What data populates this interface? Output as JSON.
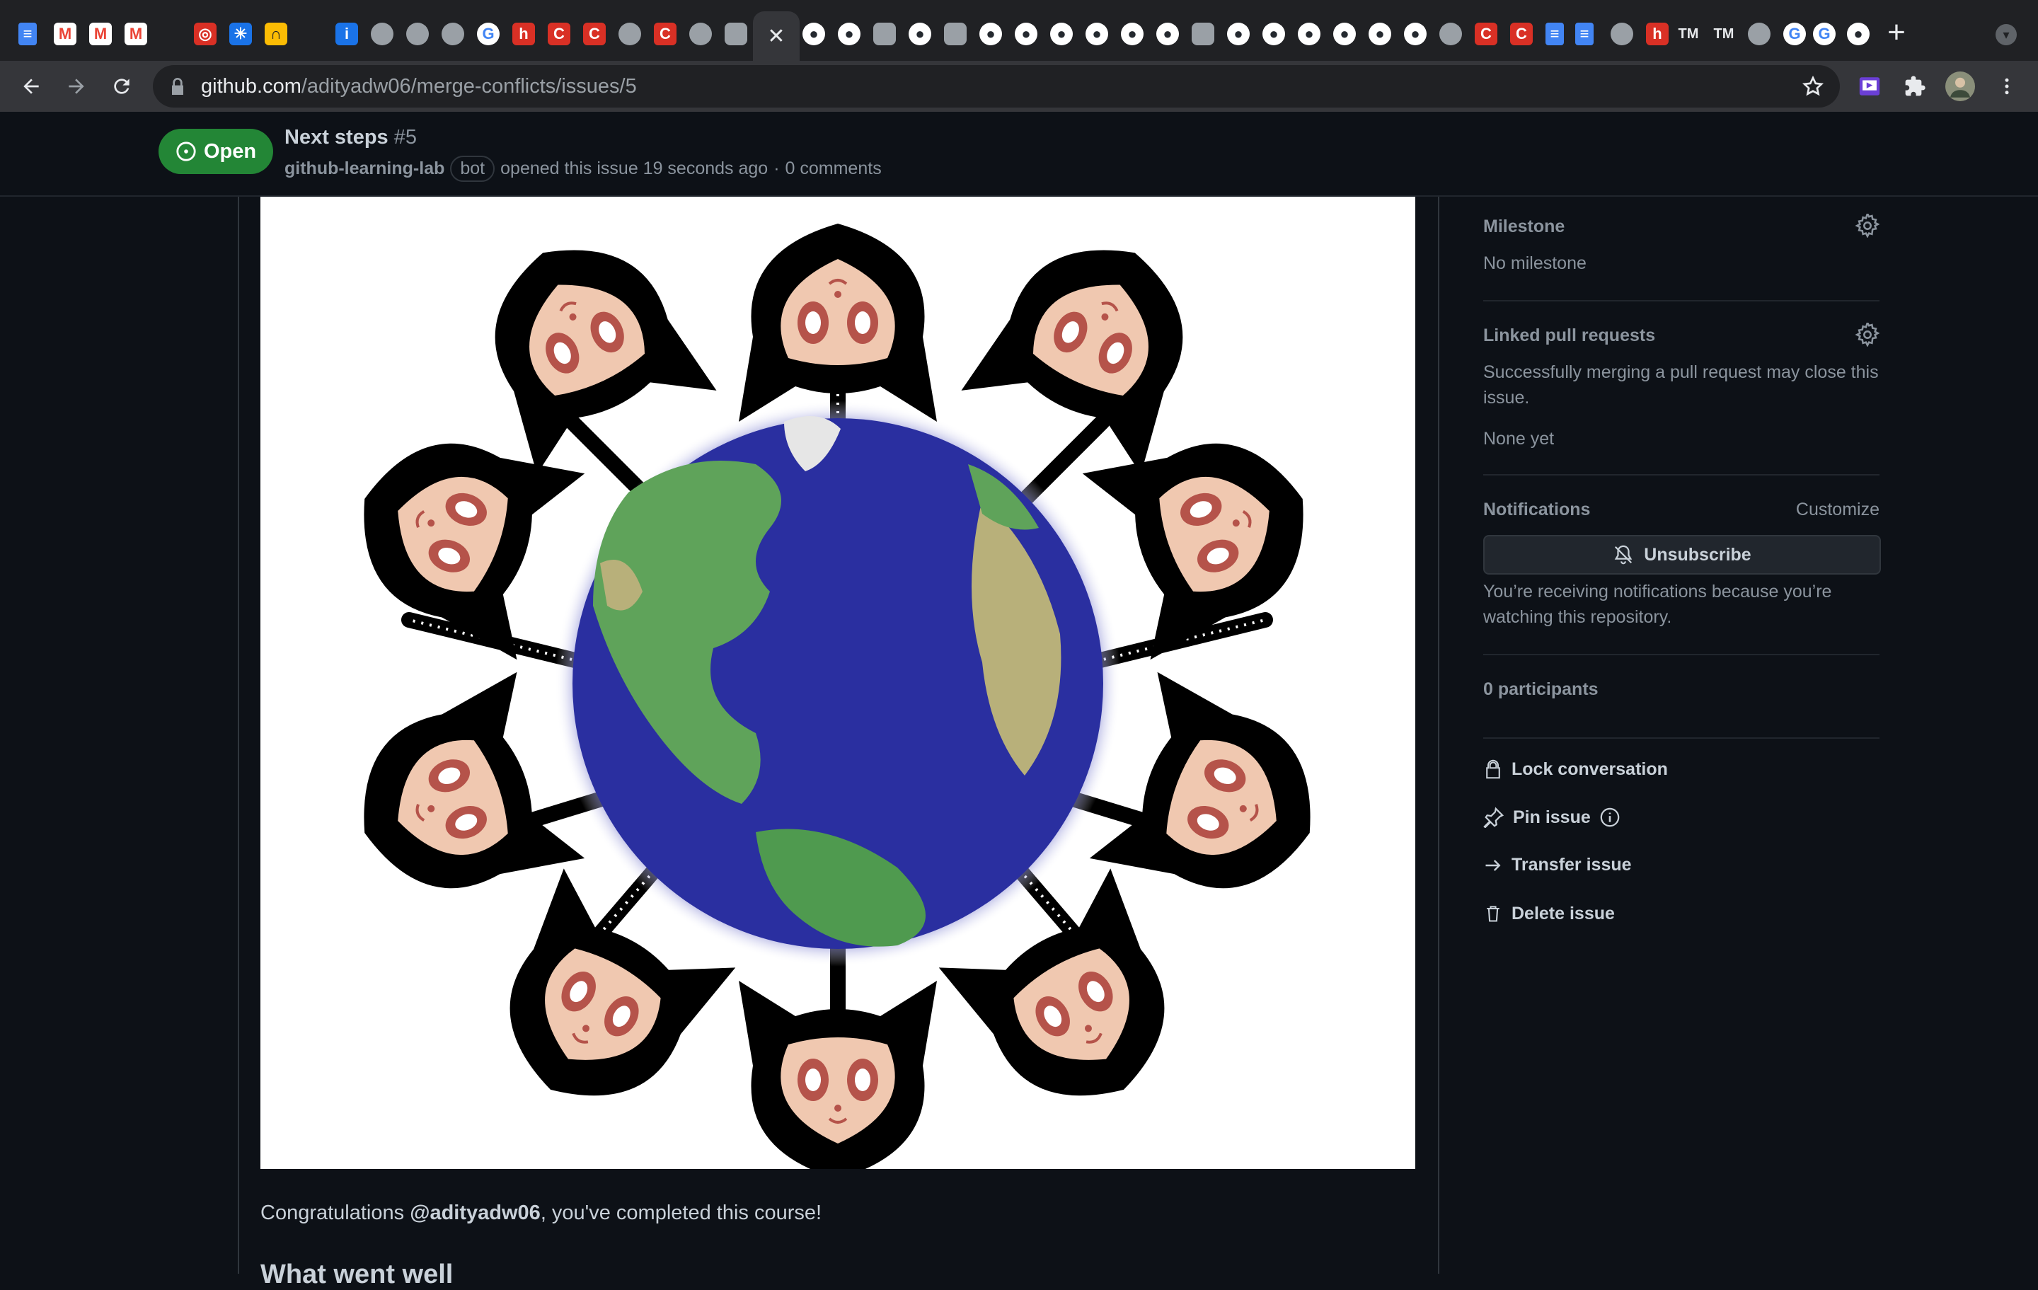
{
  "browser": {
    "active_tab_close": "✕",
    "new_tab": "+",
    "tab_search": "▾",
    "favicons": [
      {
        "kind": "fav-docs",
        "glyph": "≡"
      },
      {
        "kind": "fav-gmail",
        "glyph": "M"
      },
      {
        "kind": "fav-gmail",
        "glyph": "M"
      },
      {
        "kind": "fav-gmail",
        "glyph": "M"
      },
      {
        "kind": "fav-red",
        "glyph": "◎"
      },
      {
        "kind": "fav-blue",
        "glyph": "✳"
      },
      {
        "kind": "fav-yellow",
        "glyph": "∩"
      },
      {
        "kind": "fav-blue",
        "glyph": "i"
      },
      {
        "kind": "fav-globe",
        "glyph": ""
      },
      {
        "kind": "fav-globe",
        "glyph": ""
      },
      {
        "kind": "fav-globe",
        "glyph": ""
      },
      {
        "kind": "fav-google",
        "glyph": "G"
      },
      {
        "kind": "fav-red",
        "glyph": "h"
      },
      {
        "kind": "fav-red",
        "glyph": "C"
      },
      {
        "kind": "fav-red",
        "glyph": "C"
      },
      {
        "kind": "fav-globe",
        "glyph": ""
      },
      {
        "kind": "fav-red",
        "glyph": "C"
      },
      {
        "kind": "fav-globe",
        "glyph": ""
      },
      {
        "kind": "fav-cat",
        "glyph": ""
      },
      {
        "kind": "fav-gh",
        "glyph": "●"
      },
      {
        "kind": "fav-gh",
        "glyph": "●"
      },
      {
        "kind": "fav-cat",
        "glyph": ""
      },
      {
        "kind": "fav-gh",
        "glyph": "●"
      },
      {
        "kind": "fav-cat",
        "glyph": ""
      },
      {
        "kind": "fav-gh",
        "glyph": "●"
      },
      {
        "kind": "fav-gh",
        "glyph": "●"
      },
      {
        "kind": "fav-gh",
        "glyph": "●"
      },
      {
        "kind": "fav-gh",
        "glyph": "●"
      },
      {
        "kind": "fav-gh",
        "glyph": "●"
      },
      {
        "kind": "fav-gh",
        "glyph": "●"
      },
      {
        "kind": "fav-cat",
        "glyph": ""
      },
      {
        "kind": "fav-gh",
        "glyph": "●"
      },
      {
        "kind": "fav-gh",
        "glyph": "●"
      },
      {
        "kind": "fav-gh",
        "glyph": "●"
      },
      {
        "kind": "fav-gh",
        "glyph": "●"
      },
      {
        "kind": "fav-gh",
        "glyph": "●"
      },
      {
        "kind": "fav-gh",
        "glyph": "●"
      },
      {
        "kind": "fav-globe",
        "glyph": ""
      },
      {
        "kind": "fav-red",
        "glyph": "C"
      },
      {
        "kind": "fav-red",
        "glyph": "C"
      },
      {
        "kind": "fav-docs",
        "glyph": "≡"
      },
      {
        "kind": "fav-docs",
        "glyph": "≡"
      },
      {
        "kind": "fav-globe",
        "glyph": ""
      },
      {
        "kind": "fav-red",
        "glyph": "h"
      },
      {
        "kind": "fav-tm",
        "glyph": "TM"
      },
      {
        "kind": "fav-tm",
        "glyph": "TM"
      },
      {
        "kind": "fav-globe",
        "glyph": ""
      },
      {
        "kind": "fav-google",
        "glyph": "G"
      },
      {
        "kind": "fav-google",
        "glyph": "G"
      },
      {
        "kind": "fav-gh",
        "glyph": "●"
      }
    ]
  },
  "toolbar": {
    "url_host": "github.com",
    "url_path": "/adityadw06/merge-conflicts/issues/5"
  },
  "issue": {
    "state": "Open",
    "title": "Next steps",
    "number": "#5",
    "author": "github-learning-lab",
    "author_badge": "bot",
    "opened_text": "opened this issue 19 seconds ago",
    "separator": "·",
    "comments": "0 comments"
  },
  "comment": {
    "congrats_prefix": "Congratulations ",
    "mention": "@adityadw06",
    "congrats_suffix": ", you've completed this course!",
    "next_heading": "What went well"
  },
  "sidebar": {
    "milestone": {
      "heading": "Milestone",
      "value": "No milestone"
    },
    "linked_prs": {
      "heading": "Linked pull requests",
      "description": "Successfully merging a pull request may close this issue.",
      "value": "None yet"
    },
    "notifications": {
      "heading": "Notifications",
      "customize": "Customize",
      "unsubscribe": "Unsubscribe",
      "reason": "You’re receiving notifications because you’re watching this repository."
    },
    "participants": "0 participants",
    "actions": {
      "lock": "Lock conversation",
      "pin": "Pin issue",
      "transfer": "Transfer issue",
      "delete": "Delete issue"
    }
  },
  "colors": {
    "background": "#0d1117",
    "open_badge": "#238636",
    "border": "#30363d",
    "muted_text": "#8b949e"
  }
}
